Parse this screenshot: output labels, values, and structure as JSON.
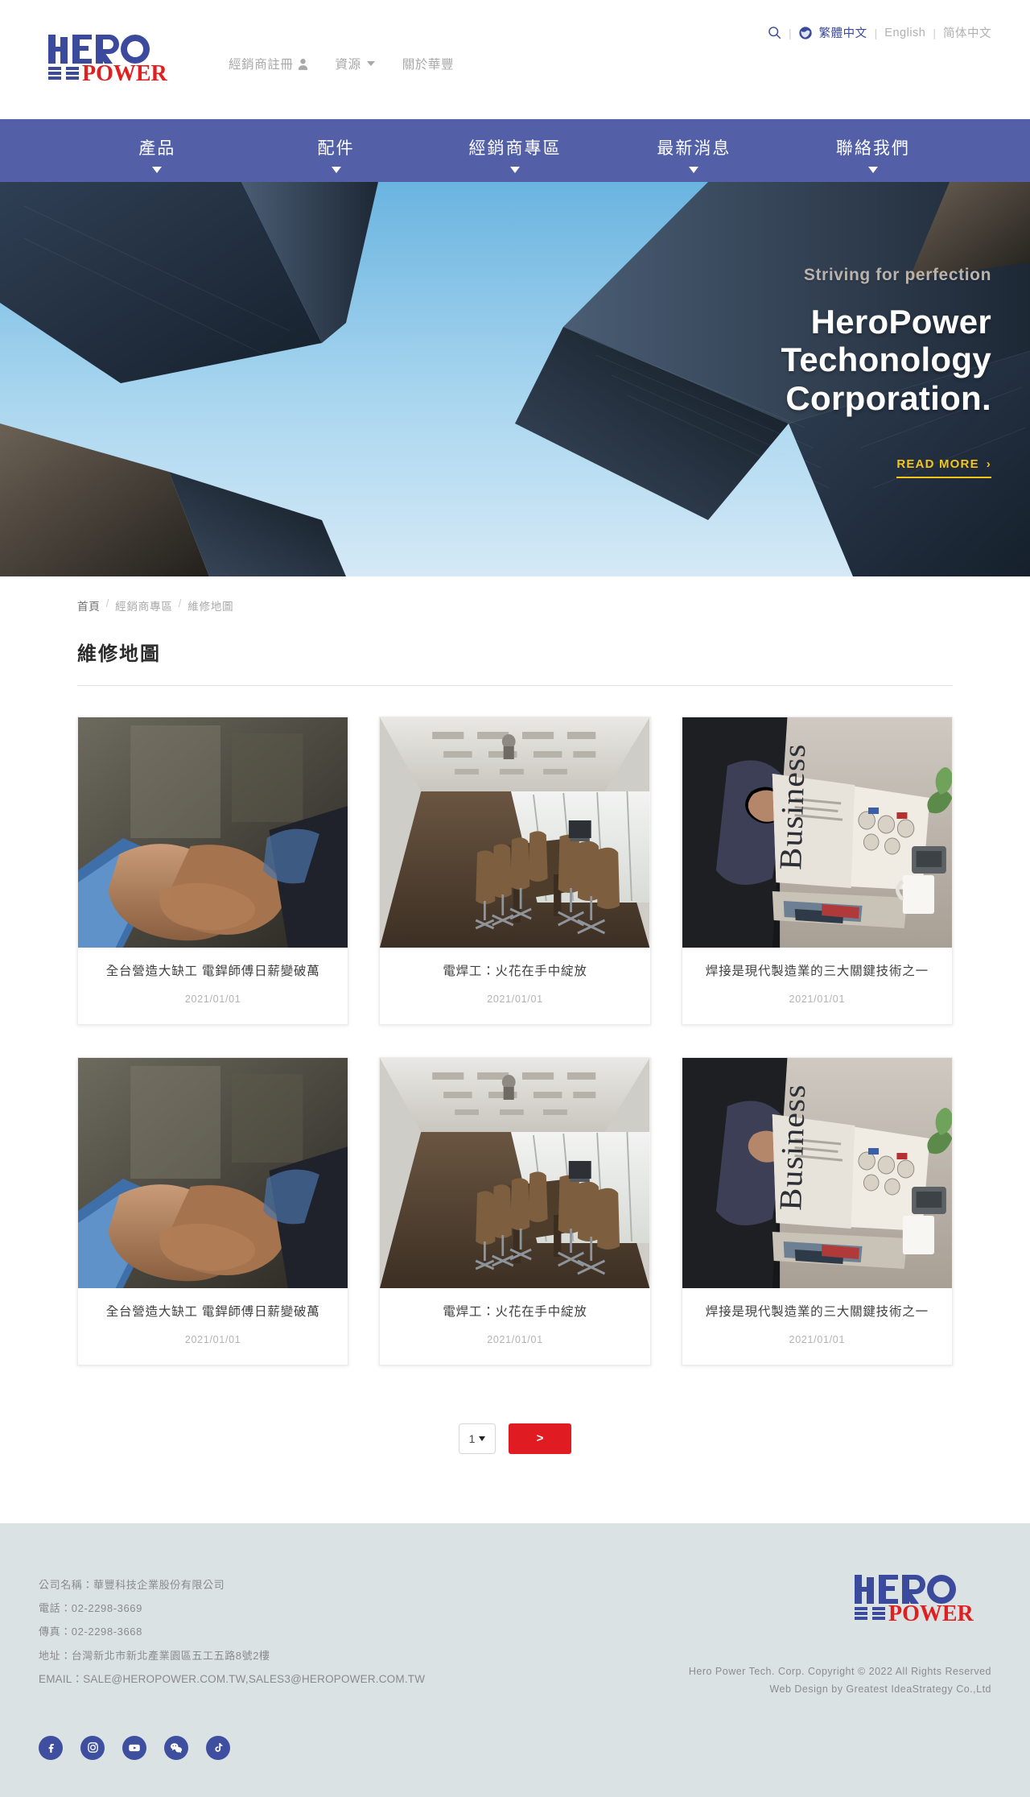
{
  "brand": {
    "logo_hero": "HERO",
    "logo_power": "POWER",
    "color_blue": "#3b4a9c",
    "color_red": "#e02020",
    "nav_bg": "#5360a8",
    "accent_yellow": "#f5c518",
    "footer_bg": "#dbe2e4"
  },
  "header": {
    "nav": [
      {
        "label": "經銷商註冊",
        "icon": "person-icon"
      },
      {
        "label": "資源",
        "icon": "chevron-down-icon"
      },
      {
        "label": "關於華豐",
        "icon": ""
      }
    ],
    "search_icon": "search-icon",
    "globe_icon": "globe-icon",
    "languages": [
      {
        "label": "繁體中文",
        "active": true
      },
      {
        "label": "English",
        "active": false
      },
      {
        "label": "简体中文",
        "active": false
      }
    ],
    "separator": "|"
  },
  "mainnav": {
    "items": [
      {
        "label": "產品",
        "caret": true
      },
      {
        "label": "配件",
        "caret": true
      },
      {
        "label": "經銷商專區",
        "caret": true
      },
      {
        "label": "最新消息",
        "caret": true
      },
      {
        "label": "聯絡我們",
        "caret": true
      }
    ]
  },
  "hero": {
    "kicker": "Striving for perfection",
    "title_line1": "HeroPower",
    "title_line2": "Techonology",
    "title_line3": "Corporation.",
    "cta": "READ MORE",
    "cta_arrow": "›"
  },
  "breadcrumb": {
    "items": [
      "首頁",
      "經銷商專區",
      "維修地圖"
    ],
    "separator": "/"
  },
  "page": {
    "title": "維修地圖"
  },
  "cards": [
    {
      "title": "全台營造大缺工 電銲師傅日薪變破萬",
      "date": "2021/01/01",
      "image": "handshake"
    },
    {
      "title": "電焊工：火花在手中綻放",
      "date": "2021/01/01",
      "image": "conference-room"
    },
    {
      "title": "焊接是現代製造業的三大關鍵技術之一",
      "date": "2021/01/01",
      "image": "newspaper"
    },
    {
      "title": "全台營造大缺工 電銲師傅日薪變破萬",
      "date": "2021/01/01",
      "image": "handshake"
    },
    {
      "title": "電焊工：火花在手中綻放",
      "date": "2021/01/01",
      "image": "conference-room"
    },
    {
      "title": "焊接是現代製造業的三大關鍵技術之一",
      "date": "2021/01/01",
      "image": "newspaper"
    }
  ],
  "pagination": {
    "current_page": "1",
    "next_label": ">"
  },
  "footer": {
    "company": "公司名稱：華豐科技企業股份有限公司",
    "phone": "電話：02-2298-3669",
    "fax": "傳真：02-2298-3668",
    "address": "地址：台灣新北市新北產業園區五工五路8號2樓",
    "email": "EMAIL：SALE@HEROPOWER.COM.TW,SALES3@HEROPOWER.COM.TW",
    "copyright_line1": "Hero Power Tech. Corp. Copyright © 2022 All Rights Reserved",
    "copyright_line2": "Web Design by Greatest IdeaStrategy Co.,Ltd",
    "socials": [
      {
        "name": "facebook-icon"
      },
      {
        "name": "instagram-icon"
      },
      {
        "name": "youtube-icon"
      },
      {
        "name": "wechat-icon"
      },
      {
        "name": "tiktok-icon"
      }
    ]
  }
}
